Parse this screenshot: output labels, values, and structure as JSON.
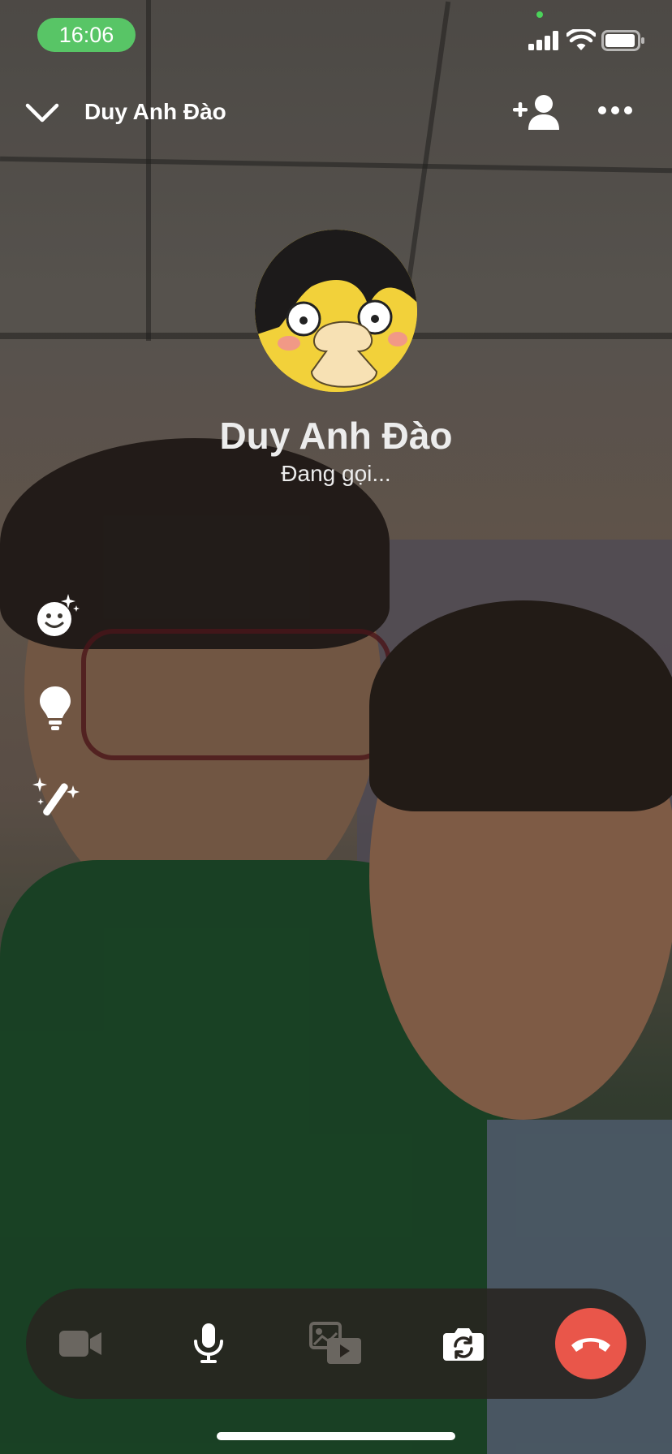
{
  "status_bar": {
    "time": "16:06"
  },
  "header": {
    "caller_name": "Duy Anh Đào"
  },
  "call": {
    "callee_name": "Duy Anh Đào",
    "status": "Đang gọi..."
  },
  "colors": {
    "time_pill": "#58c566",
    "end_call": "#e9564a",
    "controls_bg": "#28241f"
  },
  "icons": {
    "chevron": "chevron-down-icon",
    "add_person": "add-person-icon",
    "more": "more-icon",
    "effects": "effects-icon",
    "lightbulb": "lightbulb-icon",
    "magic_wand": "magic-wand-icon",
    "camera": "video-camera-icon",
    "microphone": "microphone-icon",
    "media_share": "media-share-icon",
    "flip_camera": "flip-camera-icon",
    "end_call": "end-call-icon"
  }
}
